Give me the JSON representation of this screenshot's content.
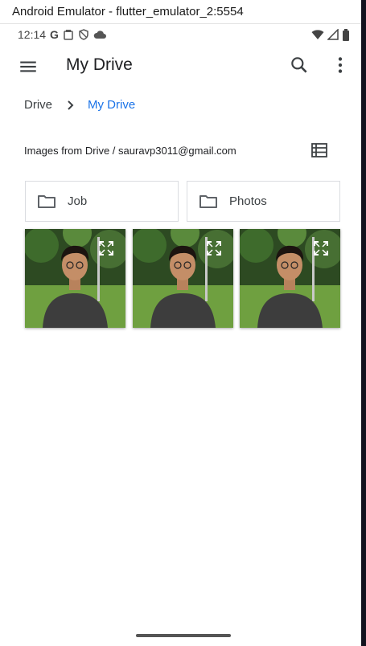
{
  "window": {
    "title": "Android Emulator - flutter_emulator_2:5554"
  },
  "status_bar": {
    "time": "12:14",
    "left_icons": [
      "google-g-icon",
      "clipboard-icon",
      "shield-icon",
      "cloud-icon"
    ],
    "right_icons": [
      "wifi-icon",
      "signal-icon",
      "battery-icon"
    ]
  },
  "app_bar": {
    "title": "My Drive",
    "actions": [
      "search-icon",
      "more-vert-icon"
    ]
  },
  "breadcrumb": {
    "root": "Drive",
    "current": "My Drive",
    "current_color": "#1a73e8"
  },
  "section": {
    "header": "Images from Drive / sauravp3011@gmail.com"
  },
  "folders": [
    {
      "name": "Job"
    },
    {
      "name": "Photos"
    }
  ],
  "images": [
    {
      "icon": "expand-icon"
    },
    {
      "icon": "expand-icon"
    },
    {
      "icon": "expand-icon"
    }
  ]
}
